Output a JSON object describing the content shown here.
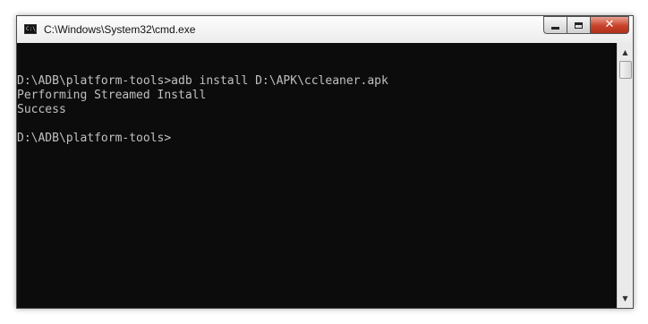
{
  "window": {
    "title": "C:\\Windows\\System32\\cmd.exe",
    "icon": "cmd-console-icon",
    "icon_text": "C:\\_"
  },
  "caption_buttons": {
    "minimize_icon": "minimize-icon",
    "maximize_icon": "maximize-icon",
    "close_icon": "close-icon",
    "close_glyph": "✕"
  },
  "console": {
    "lines": [
      "",
      "D:\\ADB\\platform-tools>adb install D:\\APK\\ccleaner.apk",
      "Performing Streamed Install",
      "Success",
      "",
      "D:\\ADB\\platform-tools>"
    ]
  },
  "scrollbar": {
    "up_glyph": "▲",
    "down_glyph": "▼"
  },
  "colors": {
    "console_bg": "#0c0c0c",
    "console_text": "#c0c0c0",
    "close_button": "#c7422a"
  }
}
